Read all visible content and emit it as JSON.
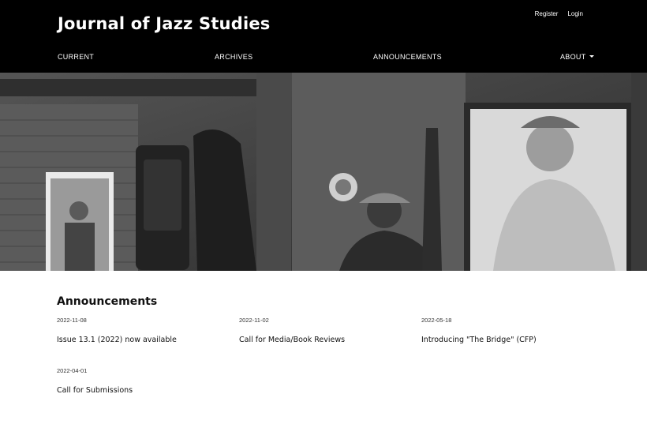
{
  "header": {
    "site_title": "Journal of Jazz Studies",
    "user_nav": {
      "register": "Register",
      "login": "Login"
    },
    "primary_nav": {
      "current": "CURRENT",
      "archives": "ARCHIVES",
      "announcements": "ANNOUNCEMENTS",
      "about": "ABOUT"
    },
    "about_icon": "caret-down-icon"
  },
  "hero": {
    "image": "black-and-white photo of jazz musician playing upright bass in a club"
  },
  "announcements": {
    "heading": "Announcements",
    "items": [
      {
        "date": "2022-11-08",
        "title": "Issue 13.1 (2022) now available"
      },
      {
        "date": "2022-11-02",
        "title": "Call for Media/Book Reviews"
      },
      {
        "date": "2022-05-18",
        "title": "Introducing \"The Bridge\" (CFP)"
      },
      {
        "date": "2022-04-01",
        "title": "Call for Submissions"
      }
    ]
  },
  "colors": {
    "header_bg": "#000000",
    "header_text": "#ffffff",
    "body_bg": "#ffffff"
  }
}
